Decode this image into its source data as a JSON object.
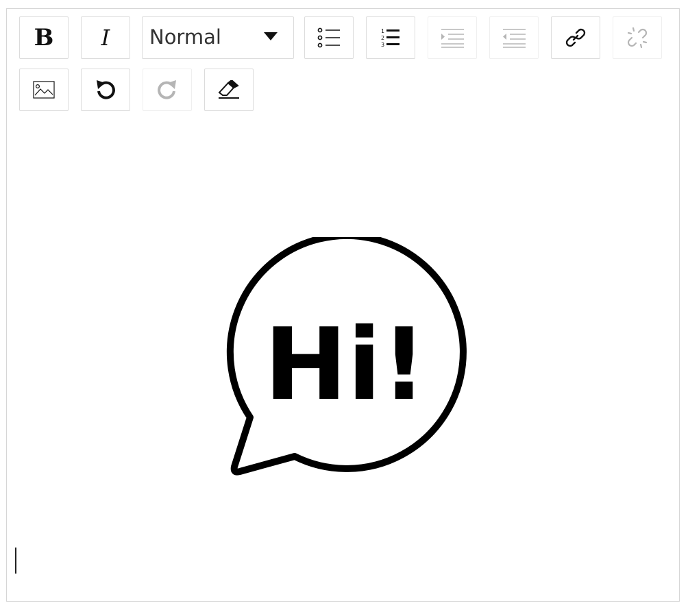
{
  "toolbar": {
    "bold_label": "B",
    "italic_label": "I",
    "format_select": {
      "value": "Normal",
      "options": [
        "Normal"
      ]
    },
    "buttons": [
      {
        "name": "bold-button",
        "icon": "bold-icon",
        "enabled": true
      },
      {
        "name": "italic-button",
        "icon": "italic-icon",
        "enabled": true
      },
      {
        "name": "bulleted-list-button",
        "icon": "bulleted-list-icon",
        "enabled": true
      },
      {
        "name": "numbered-list-button",
        "icon": "numbered-list-icon",
        "enabled": true
      },
      {
        "name": "indent-button",
        "icon": "indent-icon",
        "enabled": false
      },
      {
        "name": "outdent-button",
        "icon": "outdent-icon",
        "enabled": false
      },
      {
        "name": "link-button",
        "icon": "link-icon",
        "enabled": true
      },
      {
        "name": "unlink-button",
        "icon": "unlink-icon",
        "enabled": false
      },
      {
        "name": "image-button",
        "icon": "image-icon",
        "enabled": true
      },
      {
        "name": "undo-button",
        "icon": "undo-icon",
        "enabled": true
      },
      {
        "name": "redo-button",
        "icon": "redo-icon",
        "enabled": false
      },
      {
        "name": "clear-formatting-button",
        "icon": "eraser-icon",
        "enabled": true
      }
    ]
  },
  "content": {
    "image": {
      "name": "hi-speech-bubble-image",
      "text": "Hi!"
    }
  },
  "colors": {
    "border": "#d6d6d6",
    "button_border": "#dcdcdc",
    "disabled_icon": "#b5b5b5",
    "icon": "#111111"
  }
}
